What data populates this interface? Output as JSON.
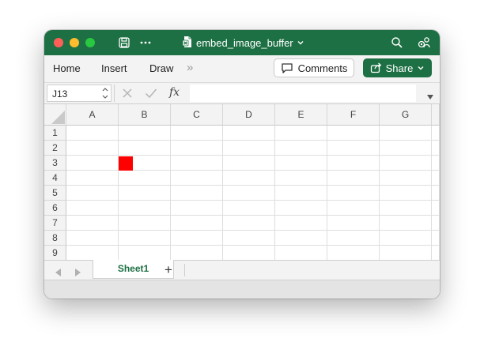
{
  "window": {
    "title": "embed_image_buffer"
  },
  "ribbon": {
    "tabs": [
      {
        "label": "Home"
      },
      {
        "label": "Insert"
      },
      {
        "label": "Draw"
      }
    ],
    "more_glyph": "»",
    "comments_label": "Comments",
    "share_label": "Share"
  },
  "formula_bar": {
    "cell_ref": "J13",
    "fx_label": "fx",
    "value": ""
  },
  "sheet": {
    "columns": [
      "A",
      "B",
      "C",
      "D",
      "E",
      "F",
      "G"
    ],
    "rows": [
      "1",
      "2",
      "3",
      "4",
      "5",
      "6",
      "7",
      "8",
      "9"
    ],
    "embedded_image": {
      "cell": "B3",
      "color": "#ff0000"
    }
  },
  "tabs": {
    "sheets": [
      {
        "label": "Sheet1",
        "active": true
      }
    ],
    "add_label": "+"
  },
  "colors": {
    "brand": "#1d7044",
    "image_fill": "#ff0000"
  }
}
